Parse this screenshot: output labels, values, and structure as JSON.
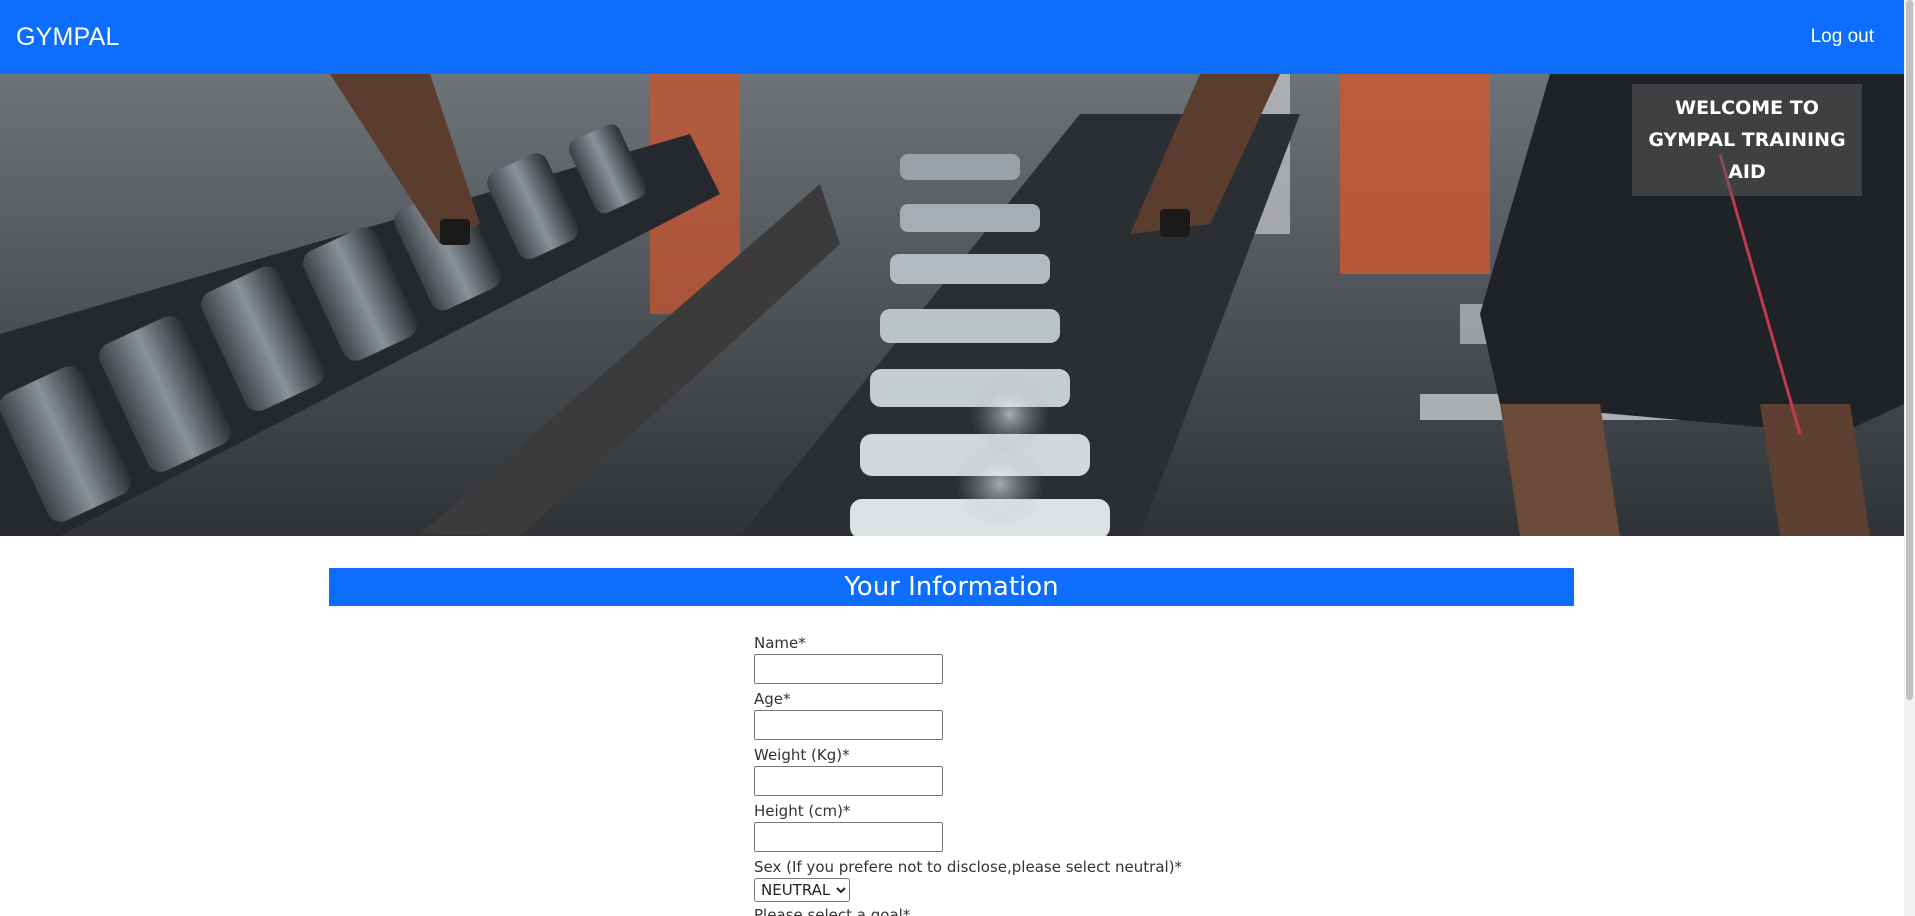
{
  "navbar": {
    "brand": "GYMPAL",
    "logout": "Log out",
    "color": "#0d6efd"
  },
  "hero": {
    "welcome": "WELCOME TO GYMPAL TRAINING AID",
    "image": "gym-dumbbells-photo"
  },
  "section": {
    "title": "Your Information"
  },
  "form": {
    "name_label": "Name*",
    "age_label": "Age*",
    "weight_label": "Weight (Kg)*",
    "height_label": "Height (cm)*",
    "sex_label": "Sex (If you prefere not to disclose,please select neutral)*",
    "sex_value": "NEUTRAL",
    "goal_label": "Please select a goal*"
  }
}
